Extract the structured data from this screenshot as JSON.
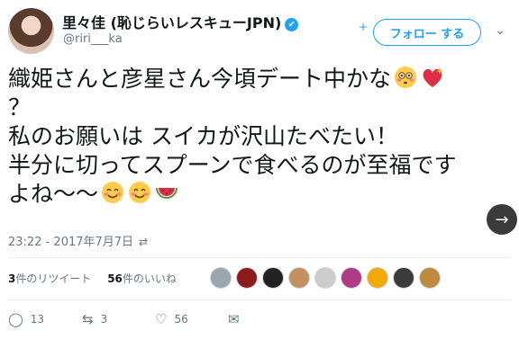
{
  "user": {
    "display_name": "里々佳 (恥じらいレスキューJPN)",
    "verified_mark": "✔",
    "handle": "@riri___ka",
    "avatar_icon": "avatar-photo"
  },
  "header": {
    "follow_label": "フォロー する",
    "follow_plus": "+",
    "more_caret": "⌄"
  },
  "tweet": {
    "lines": [
      "織姫さんと彦星さん今頃デート中かな",
      "？",
      "私のお願いは スイカが沢山たべたい！",
      "半分に切ってスプーンで食べるのが至福です",
      "よね〜〜"
    ],
    "emojis": [
      "flushed-face",
      "sparkling-heart",
      "smiling-face",
      "smiling-face",
      "watermelon"
    ]
  },
  "meta": {
    "timestamp": "23:22 - 2017年7月7日",
    "translate_icon": "⇄"
  },
  "stats": {
    "retweets_count": "3",
    "retweets_label": "件のリツイート",
    "likes_count": "56",
    "likes_label": "件のいいね"
  },
  "likers": [
    "#9aa5ad",
    "#8c1c1c",
    "#222222",
    "#c49060",
    "#cccccc",
    "#b03a86",
    "#f2a900",
    "#3b3b3b",
    "#c08a3e"
  ],
  "actions": {
    "reply_count": "13",
    "retweet_count": "3",
    "like_count": "56",
    "reply_icon": "◯",
    "retweet_icon": "⇆",
    "like_icon": "♡",
    "dm_icon": "✉"
  },
  "nav": {
    "next_icon": "→"
  },
  "colors": {
    "accent": "#1da1f2",
    "muted": "#657786",
    "text": "#14171a"
  }
}
